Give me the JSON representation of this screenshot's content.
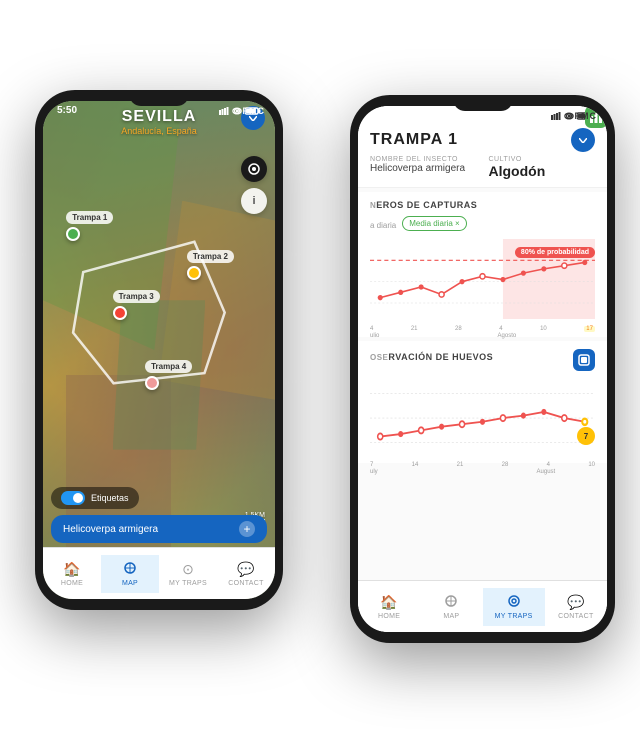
{
  "scene": {
    "bg_color": "#e8e8e8"
  },
  "left_phone": {
    "status_bar": {
      "time": "5:50",
      "fmc": "+FMC"
    },
    "header": {
      "city": "SEVILLA",
      "subtitle": "Andalucía, España"
    },
    "map": {
      "traps": [
        {
          "label": "Trampa 1",
          "color": "green",
          "top": "22%",
          "left": "14%"
        },
        {
          "label": "Trampa 2",
          "color": "yellow",
          "top": "32%",
          "left": "68%"
        },
        {
          "label": "Trampa 3",
          "color": "red",
          "top": "40%",
          "left": "38%"
        },
        {
          "label": "Trampa 4",
          "color": "red-light",
          "top": "55%",
          "left": "50%"
        }
      ]
    },
    "bottom": {
      "labels_toggle": "Etiquetas",
      "insect_name": "Helicoverpa armigera",
      "scale": "1.5KM"
    },
    "nav": [
      {
        "label": "HOME",
        "icon": "🏠",
        "active": false
      },
      {
        "label": "MAP",
        "icon": "⏻",
        "active": true
      },
      {
        "label": "MY TRAPS",
        "icon": "⊙",
        "active": false
      },
      {
        "label": "CONTACT",
        "icon": "💬",
        "active": false
      }
    ]
  },
  "right_phone": {
    "status_bar": {
      "fmc": "+FMC"
    },
    "header": {
      "trap_name": "TRAMPA 1",
      "insect_label": "NOMBRE DEL INSECTO",
      "insect_value": "Helicoverpa armigera",
      "crop_label": "CULTIVO",
      "crop_value": "Algodón"
    },
    "captures_section": {
      "title": "EROS DE CAPTURAS",
      "daily_label": "a diaria",
      "media_badge": "Media diaria ×",
      "probability_badge": "80% de probabilidad",
      "x_axis": [
        "4",
        "21",
        "28",
        "4",
        "10",
        "17"
      ],
      "x_months": [
        "ulio",
        "",
        "",
        "Agosto",
        "",
        ""
      ]
    },
    "eggs_section": {
      "title": "RVACIÓN DE HUEVOS",
      "x_axis": [
        "7",
        "14",
        "21",
        "28",
        "4",
        "10"
      ],
      "x_months": [
        "uly",
        "",
        "",
        "",
        "August",
        ""
      ],
      "circle_value": "7"
    },
    "nav": [
      {
        "label": "HOME",
        "icon": "🏠",
        "active": false
      },
      {
        "label": "MAP",
        "icon": "⏻",
        "active": false
      },
      {
        "label": "MY TRAPS",
        "icon": "⊙",
        "active": true
      },
      {
        "label": "CONTACT",
        "icon": "💬",
        "active": false
      }
    ]
  }
}
